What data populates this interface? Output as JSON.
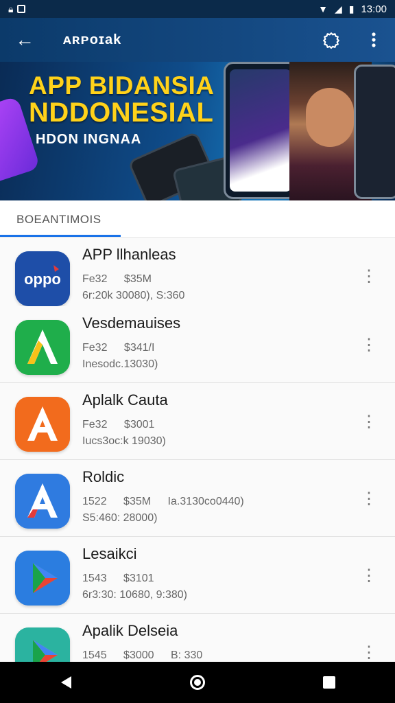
{
  "status_bar": {
    "time": "13:00",
    "left_icons": [
      "lock-icon",
      "image-icon"
    ],
    "right_icons": [
      "wifi-icon",
      "signal-icon",
      "battery-icon"
    ]
  },
  "app_bar": {
    "title": "ᴀʀᴘoɪak",
    "back_icon": "←",
    "action_icons": [
      "settings-gear-icon",
      "more-vert-icon"
    ]
  },
  "hero": {
    "line1": "APP BIDANSIA",
    "line2": "NDDONESIAL",
    "line3": "HDON INGNAA"
  },
  "tabs": {
    "active_label": "BOEANTIMOIS"
  },
  "apps": [
    {
      "name": "APP llhanleas",
      "size": "Fe32",
      "price": "$35M",
      "detail": "6r:20k 30080), S:360",
      "icon": "oppo-logo-icon",
      "color": "#1e5fb8"
    },
    {
      "name": "Vesdemauises",
      "size": "Fe32",
      "price": "$341/I",
      "detail": "Inesodc.13030)",
      "icon": "green-a-icon",
      "color": "#1fae4b"
    },
    {
      "name": "Aplalk Cauta",
      "size": "Fe32",
      "price": "$3001",
      "detail": "Iucs3oc:k 19030)",
      "icon": "orange-a-icon",
      "color": "#f26b1d"
    },
    {
      "name": "Roldic",
      "size": "1522",
      "price": "$35M",
      "extra": "Ia.3130co0440)",
      "detail": "S5:460: 28000)",
      "icon": "blue-a-icon",
      "color": "#2f7be0"
    },
    {
      "name": "Lesaikci",
      "size": "1543",
      "price": "$3101",
      "detail": "6r3:30: 10680, 9:380)",
      "icon": "play-store-icon",
      "color": "#2b7de0"
    },
    {
      "name": "Apalik Delseia",
      "size": "1545",
      "price": "$3000",
      "detail2": "B: 330",
      "icon": "play-store-icon",
      "color": "#2bb3a0"
    }
  ],
  "more_glyph": "⋮",
  "nav_bar": [
    "back-icon",
    "home-icon",
    "recents-icon"
  ]
}
